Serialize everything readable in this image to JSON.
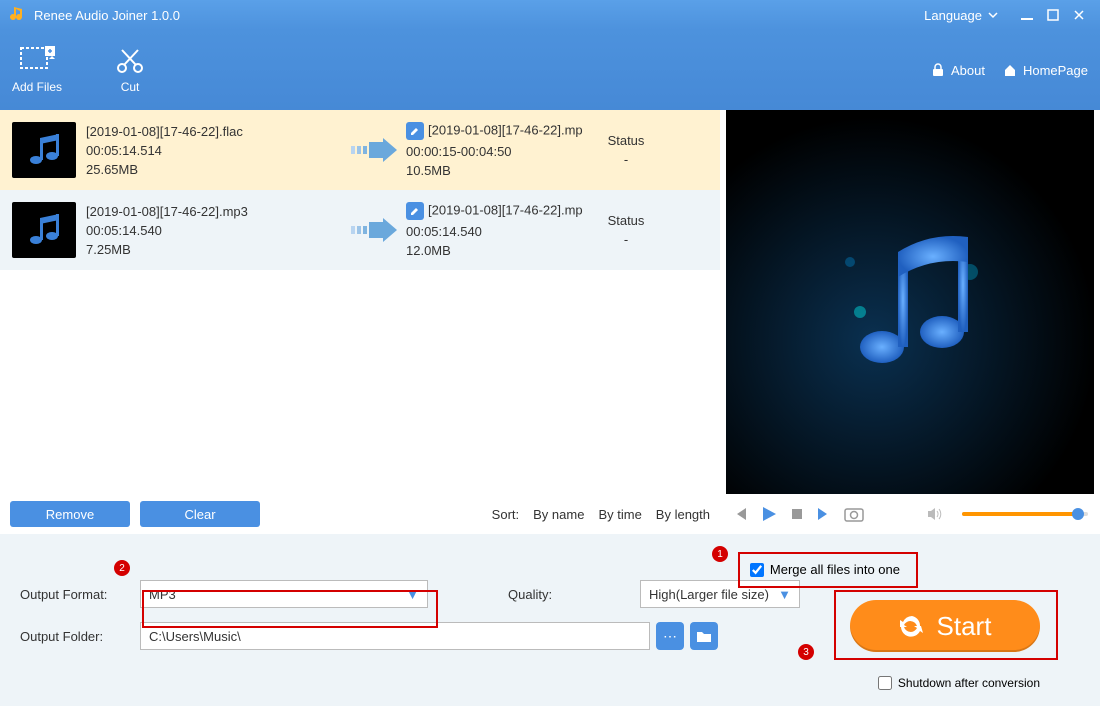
{
  "title": "Renee Audio Joiner 1.0.0",
  "titlebar": {
    "language": "Language"
  },
  "toolbar": {
    "add_files": "Add Files",
    "cut": "Cut",
    "about": "About",
    "homepage": "HomePage"
  },
  "files": [
    {
      "name": "[2019-01-08][17-46-22].flac",
      "duration": "00:05:14.514",
      "size": "25.65MB",
      "out_name": "[2019-01-08][17-46-22].mp",
      "out_range": "00:00:15-00:04:50",
      "out_size": "10.5MB",
      "status_label": "Status",
      "status_val": "-",
      "selected": true
    },
    {
      "name": "[2019-01-08][17-46-22].mp3",
      "duration": "00:05:14.540",
      "size": "7.25MB",
      "out_name": "[2019-01-08][17-46-22].mp",
      "out_range": "00:05:14.540",
      "out_size": "12.0MB",
      "status_label": "Status",
      "status_val": "-",
      "selected": false
    }
  ],
  "buttons": {
    "remove": "Remove",
    "clear": "Clear"
  },
  "sort": {
    "label": "Sort:",
    "by_name": "By name",
    "by_time": "By time",
    "by_length": "By length"
  },
  "output": {
    "format_label": "Output Format:",
    "format_value": "MP3",
    "quality_label": "Quality:",
    "quality_value": "High(Larger file size)",
    "folder_label": "Output Folder:",
    "folder_value": "C:\\Users\\Music\\"
  },
  "merge": {
    "label": "Merge all files into one",
    "checked": true
  },
  "start": "Start",
  "shutdown": {
    "label": "Shutdown after conversion",
    "checked": false
  },
  "badges": {
    "b1": "1",
    "b2": "2",
    "b3": "3"
  }
}
